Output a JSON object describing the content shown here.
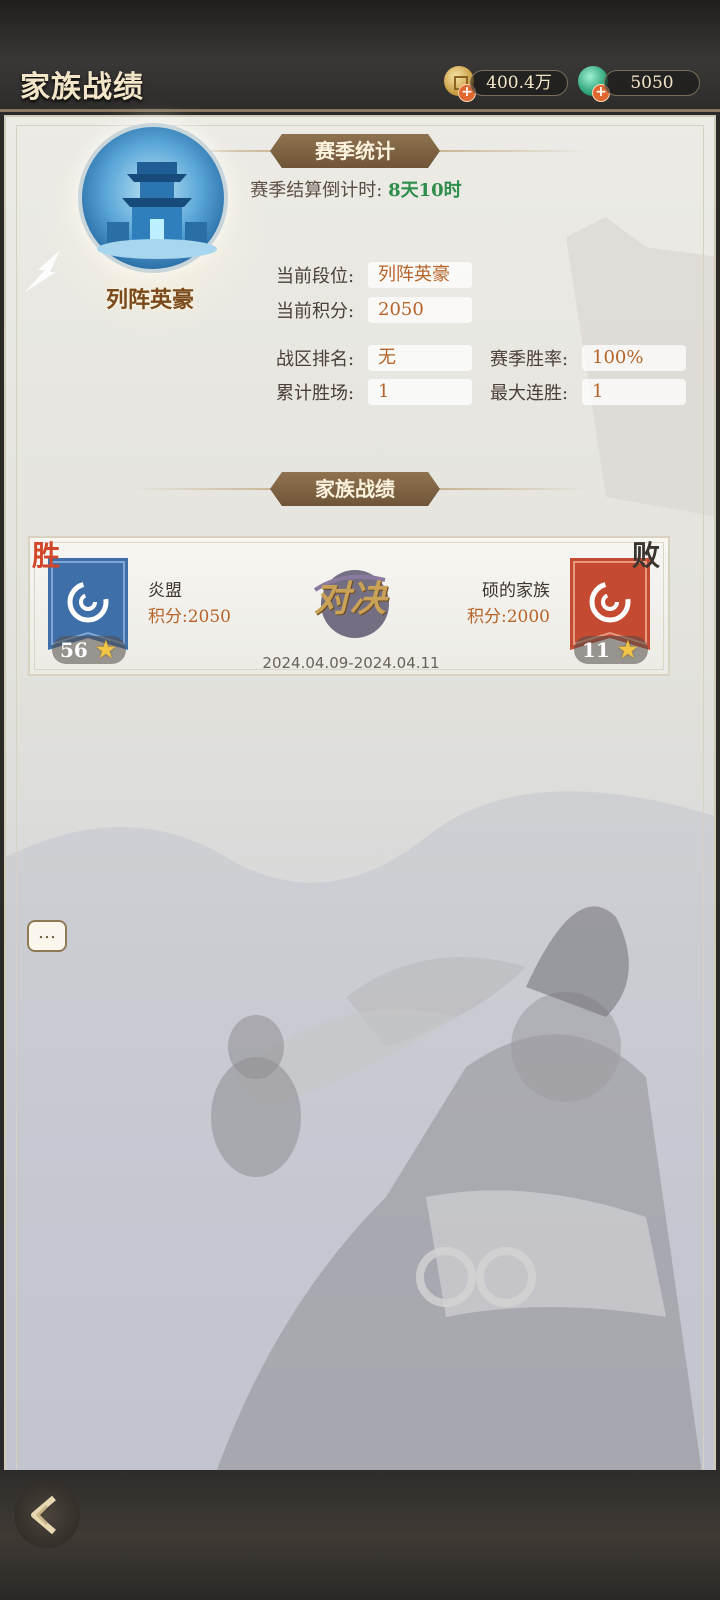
{
  "header": {
    "title": "家族战绩",
    "coins": "400.4万",
    "jade": "5050"
  },
  "season": {
    "section_title": "赛季统计",
    "countdown_label": "赛季结算倒计时:",
    "countdown_value": "8天10时",
    "rank_name": "列阵英豪",
    "stats": [
      {
        "label": "当前段位:",
        "value": "列阵英豪"
      },
      {
        "label": "当前积分:",
        "value": "2050"
      },
      {
        "label": "战区排名:",
        "value": "无"
      },
      {
        "label": "赛季胜率:",
        "value": "100%"
      },
      {
        "label": "累计胜场:",
        "value": "1"
      },
      {
        "label": "最大连胜:",
        "value": "1"
      }
    ]
  },
  "records": {
    "section_title": "家族战绩",
    "battle": {
      "left": {
        "result": "胜",
        "name": "炎盟",
        "score": "积分:2050",
        "stars": "56",
        "color": "#3f6fa8"
      },
      "right": {
        "result": "败",
        "name": "硕的家族",
        "score": "积分:2000",
        "stars": "11",
        "color": "#c44b32"
      },
      "vs": "对决",
      "date": "2024.04.09-2024.04.11"
    }
  },
  "chat_icon": "…"
}
